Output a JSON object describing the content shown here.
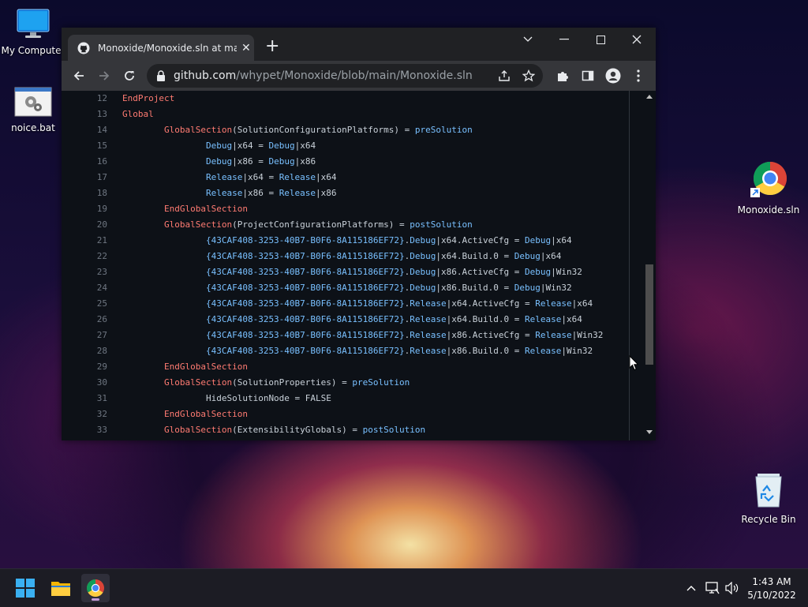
{
  "desktop": {
    "icons": [
      {
        "label": "My Computer"
      },
      {
        "label": "noice.bat"
      },
      {
        "label": "Monoxide.sln"
      },
      {
        "label": "Recycle Bin"
      }
    ]
  },
  "browser": {
    "tab": {
      "title": "Monoxide/Monoxide.sln at main"
    },
    "address": {
      "host": "github.com",
      "path": "/whypet/Monoxide/blob/main/Monoxide.sln"
    }
  },
  "code": {
    "lines": [
      {
        "num": "12",
        "indent": 0,
        "tokens": [
          [
            "k",
            "EndProject"
          ]
        ]
      },
      {
        "num": "13",
        "indent": 0,
        "tokens": [
          [
            "k",
            "Global"
          ]
        ]
      },
      {
        "num": "14",
        "indent": 1,
        "tokens": [
          [
            "k",
            "GlobalSection"
          ],
          [
            "p",
            "(SolutionConfigurationPlatforms) = "
          ],
          [
            "i",
            "preSolution"
          ]
        ]
      },
      {
        "num": "15",
        "indent": 2,
        "tokens": [
          [
            "i",
            "Debug"
          ],
          [
            "p",
            "|x64 = "
          ],
          [
            "i",
            "Debug"
          ],
          [
            "p",
            "|x64"
          ]
        ]
      },
      {
        "num": "16",
        "indent": 2,
        "tokens": [
          [
            "i",
            "Debug"
          ],
          [
            "p",
            "|x86 = "
          ],
          [
            "i",
            "Debug"
          ],
          [
            "p",
            "|x86"
          ]
        ]
      },
      {
        "num": "17",
        "indent": 2,
        "tokens": [
          [
            "i",
            "Release"
          ],
          [
            "p",
            "|x64 = "
          ],
          [
            "i",
            "Release"
          ],
          [
            "p",
            "|x64"
          ]
        ]
      },
      {
        "num": "18",
        "indent": 2,
        "tokens": [
          [
            "i",
            "Release"
          ],
          [
            "p",
            "|x86 = "
          ],
          [
            "i",
            "Release"
          ],
          [
            "p",
            "|x86"
          ]
        ]
      },
      {
        "num": "19",
        "indent": 1,
        "tokens": [
          [
            "k",
            "EndGlobalSection"
          ]
        ]
      },
      {
        "num": "20",
        "indent": 1,
        "tokens": [
          [
            "k",
            "GlobalSection"
          ],
          [
            "p",
            "(ProjectConfigurationPlatforms) = "
          ],
          [
            "i",
            "postSolution"
          ]
        ]
      },
      {
        "num": "21",
        "indent": 2,
        "tokens": [
          [
            "i",
            "{43CAF408-3253-40B7-B0F6-8A115186EF72}"
          ],
          [
            "p",
            "."
          ],
          [
            "i",
            "Debug"
          ],
          [
            "p",
            "|x64.ActiveCfg = "
          ],
          [
            "i",
            "Debug"
          ],
          [
            "p",
            "|x64"
          ]
        ]
      },
      {
        "num": "22",
        "indent": 2,
        "tokens": [
          [
            "i",
            "{43CAF408-3253-40B7-B0F6-8A115186EF72}"
          ],
          [
            "p",
            "."
          ],
          [
            "i",
            "Debug"
          ],
          [
            "p",
            "|x64.Build.0 = "
          ],
          [
            "i",
            "Debug"
          ],
          [
            "p",
            "|x64"
          ]
        ]
      },
      {
        "num": "23",
        "indent": 2,
        "tokens": [
          [
            "i",
            "{43CAF408-3253-40B7-B0F6-8A115186EF72}"
          ],
          [
            "p",
            "."
          ],
          [
            "i",
            "Debug"
          ],
          [
            "p",
            "|x86.ActiveCfg = "
          ],
          [
            "i",
            "Debug"
          ],
          [
            "p",
            "|Win32"
          ]
        ]
      },
      {
        "num": "24",
        "indent": 2,
        "tokens": [
          [
            "i",
            "{43CAF408-3253-40B7-B0F6-8A115186EF72}"
          ],
          [
            "p",
            "."
          ],
          [
            "i",
            "Debug"
          ],
          [
            "p",
            "|x86.Build.0 = "
          ],
          [
            "i",
            "Debug"
          ],
          [
            "p",
            "|Win32"
          ]
        ]
      },
      {
        "num": "25",
        "indent": 2,
        "tokens": [
          [
            "i",
            "{43CAF408-3253-40B7-B0F6-8A115186EF72}"
          ],
          [
            "p",
            "."
          ],
          [
            "i",
            "Release"
          ],
          [
            "p",
            "|x64.ActiveCfg = "
          ],
          [
            "i",
            "Release"
          ],
          [
            "p",
            "|x64"
          ]
        ]
      },
      {
        "num": "26",
        "indent": 2,
        "tokens": [
          [
            "i",
            "{43CAF408-3253-40B7-B0F6-8A115186EF72}"
          ],
          [
            "p",
            "."
          ],
          [
            "i",
            "Release"
          ],
          [
            "p",
            "|x64.Build.0 = "
          ],
          [
            "i",
            "Release"
          ],
          [
            "p",
            "|x64"
          ]
        ]
      },
      {
        "num": "27",
        "indent": 2,
        "tokens": [
          [
            "i",
            "{43CAF408-3253-40B7-B0F6-8A115186EF72}"
          ],
          [
            "p",
            "."
          ],
          [
            "i",
            "Release"
          ],
          [
            "p",
            "|x86.ActiveCfg = "
          ],
          [
            "i",
            "Release"
          ],
          [
            "p",
            "|Win32"
          ]
        ]
      },
      {
        "num": "28",
        "indent": 2,
        "tokens": [
          [
            "i",
            "{43CAF408-3253-40B7-B0F6-8A115186EF72}"
          ],
          [
            "p",
            "."
          ],
          [
            "i",
            "Release"
          ],
          [
            "p",
            "|x86.Build.0 = "
          ],
          [
            "i",
            "Release"
          ],
          [
            "p",
            "|Win32"
          ]
        ]
      },
      {
        "num": "29",
        "indent": 1,
        "tokens": [
          [
            "k",
            "EndGlobalSection"
          ]
        ]
      },
      {
        "num": "30",
        "indent": 1,
        "tokens": [
          [
            "k",
            "GlobalSection"
          ],
          [
            "p",
            "(SolutionProperties) = "
          ],
          [
            "i",
            "preSolution"
          ]
        ]
      },
      {
        "num": "31",
        "indent": 2,
        "tokens": [
          [
            "p",
            "HideSolutionNode = FALSE"
          ]
        ]
      },
      {
        "num": "32",
        "indent": 1,
        "tokens": [
          [
            "k",
            "EndGlobalSection"
          ]
        ]
      },
      {
        "num": "33",
        "indent": 1,
        "tokens": [
          [
            "k",
            "GlobalSection"
          ],
          [
            "p",
            "(ExtensibilityGlobals) = "
          ],
          [
            "i",
            "postSolution"
          ]
        ]
      }
    ]
  },
  "taskbar": {
    "apps": [
      {
        "icon": "windows-start-icon"
      },
      {
        "icon": "file-explorer-icon"
      },
      {
        "icon": "chrome-icon",
        "active": true
      }
    ],
    "clock": {
      "time": "1:43 AM",
      "date": "5/10/2022"
    }
  },
  "colors": {
    "keyword": "#ff7b72",
    "identifier": "#79c0ff",
    "plain": "#c9d1d9",
    "line_number": "#6e7681",
    "code_bg": "#0d1117",
    "chrome_frame": "#202124",
    "chrome_toolbar": "#35363a"
  }
}
